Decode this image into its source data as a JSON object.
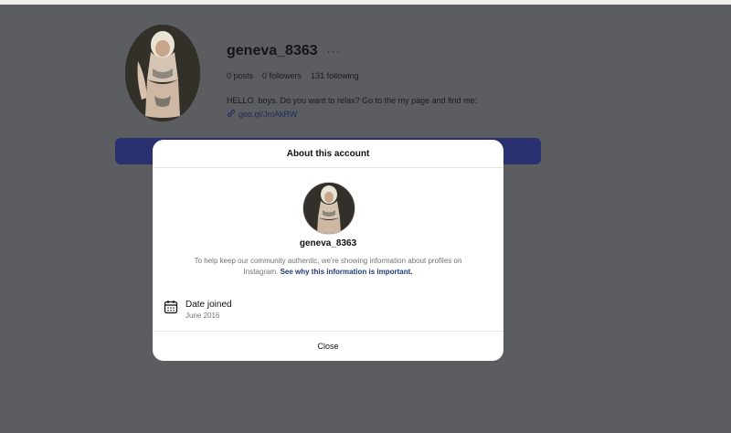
{
  "profile": {
    "username": "geneva_8363",
    "more_icon": "more-dots-icon",
    "stats": {
      "posts": "0 posts",
      "followers": "0 followers",
      "following": "131 following"
    },
    "bio": "HELLO. boys. Do you want to relax? Go to the my page and find me:",
    "link": "goo.gl/JmAkRW",
    "link_icon": "link-icon"
  },
  "modal": {
    "title": "About this account",
    "username": "geneva_8363",
    "description": "To help keep our community authentic, we're showing information about profiles on Instagram.",
    "learn_more": "See why this information is important.",
    "date_joined": {
      "label": "Date joined",
      "value": "June 2016",
      "icon": "calendar-icon"
    },
    "close_label": "Close"
  },
  "colors": {
    "backdrop": "#5b5d60",
    "button_bar": "#283070",
    "link": "#1e2a5a",
    "learn_more": "#1e3a78",
    "modal_bg": "#ffffff"
  }
}
